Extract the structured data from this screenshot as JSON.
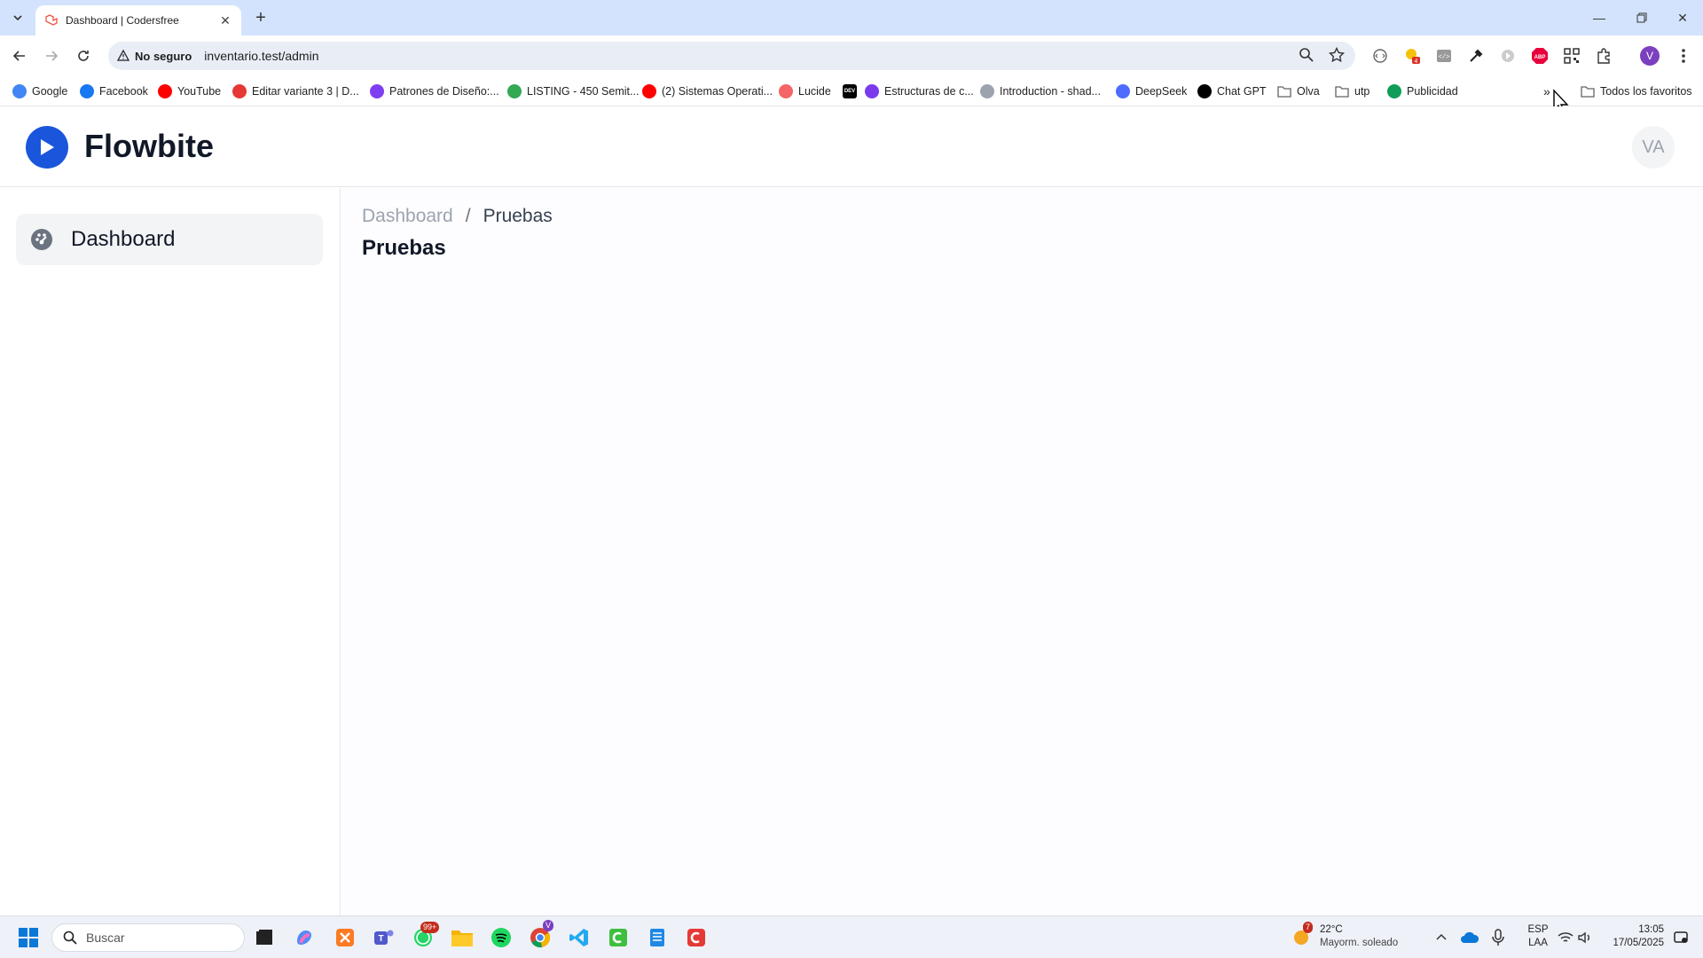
{
  "browser": {
    "tab_title": "Dashboard | Codersfree",
    "security_label": "No seguro",
    "url": "inventario.test/admin",
    "bookmarks": [
      {
        "label": "Google",
        "icon": "google-icon",
        "color": "#4285f4"
      },
      {
        "label": "Facebook",
        "icon": "facebook-icon",
        "color": "#1877f2"
      },
      {
        "label": "YouTube",
        "icon": "youtube-icon",
        "color": "#ff0000"
      },
      {
        "label": "Editar variante 3 | D...",
        "icon": "shop-icon",
        "color": "#e53935"
      },
      {
        "label": "Patrones de Diseño:...",
        "icon": "patterns-icon",
        "color": "#7e3ff2"
      },
      {
        "label": "LISTING - 450 Semit...",
        "icon": "drive-icon",
        "color": "#34a853"
      },
      {
        "label": "(2) Sistemas Operati...",
        "icon": "youtube-icon",
        "color": "#ff0000"
      },
      {
        "label": "Lucide",
        "icon": "lucide-icon",
        "color": "#f56565"
      },
      {
        "label": "",
        "icon": "dev-icon",
        "color": "#000000"
      },
      {
        "label": "Estructuras de c...",
        "icon": "structures-icon",
        "color": "#7c3aed"
      },
      {
        "label": "Introduction - shad...",
        "icon": "shadcn-icon",
        "color": "#9ca3af"
      },
      {
        "label": "DeepSeek",
        "icon": "deepseek-icon",
        "color": "#4d6bfe"
      },
      {
        "label": "Chat GPT",
        "icon": "chatgpt-icon",
        "color": "#000000"
      },
      {
        "label": "Olva",
        "icon": "folder-icon",
        "color": "#5f6368"
      },
      {
        "label": "utp",
        "icon": "folder-icon",
        "color": "#5f6368"
      },
      {
        "label": "Publicidad",
        "icon": "sheets-icon",
        "color": "#0f9d58"
      }
    ],
    "all_bookmarks_label": "Todos los favoritos",
    "profile_initial": "V"
  },
  "app": {
    "brand": "Flowbite",
    "avatar_initials": "VA",
    "sidebar": {
      "items": [
        {
          "label": "Dashboard",
          "icon": "dashboard-gauge-icon"
        }
      ]
    },
    "breadcrumb": {
      "root": "Dashboard",
      "separator": "/",
      "current": "Pruebas"
    },
    "page_title": "Pruebas",
    "accent_color": "#1a56db"
  },
  "taskbar": {
    "search_placeholder": "Buscar",
    "whatsapp_badge": "99+",
    "chrome_badge": "V",
    "weather_badge": "7",
    "weather_temp": "22°C",
    "weather_desc": "Mayorm. soleado",
    "lang_primary": "ESP",
    "lang_secondary": "LAA",
    "time": "13:05",
    "date": "17/05/2025"
  }
}
